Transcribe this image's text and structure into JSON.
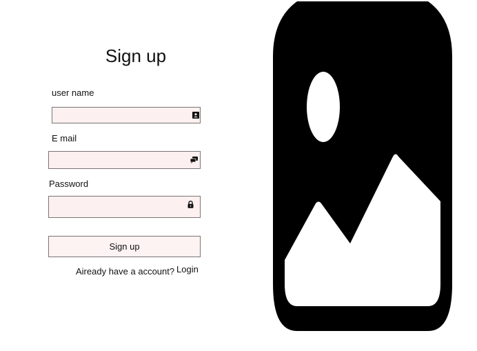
{
  "form": {
    "title": "Sign up",
    "username_label": "user name",
    "username_value": "",
    "email_label": "E mail",
    "email_value": "",
    "password_label": "Password",
    "password_value": "",
    "submit_label": "Sign up",
    "account_prompt": "Aiready have a account?",
    "login_link": "Login"
  },
  "icons": {
    "username": "contact-card-icon",
    "email": "chat-bubbles-icon",
    "password": "lock-icon",
    "hero": "image-placeholder-icon"
  },
  "colors": {
    "field_background": "#fdf0f0",
    "field_border": "#7a7373",
    "hero_fill": "#000000"
  }
}
